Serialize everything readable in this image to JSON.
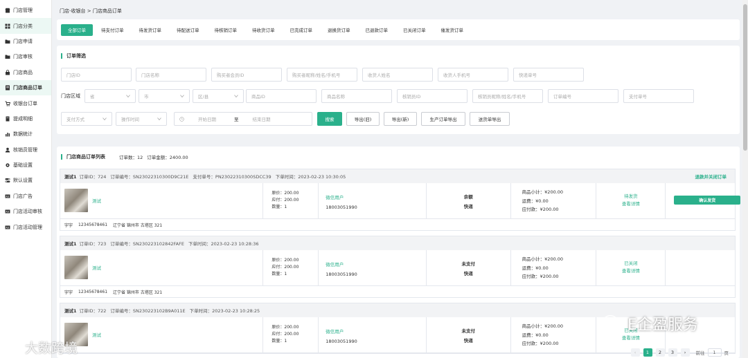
{
  "sidebar": {
    "items": [
      {
        "label": "门店管理",
        "icon": "store-icon"
      },
      {
        "label": "门店分类",
        "icon": "grid-icon",
        "active": true
      },
      {
        "label": "门店申请",
        "icon": "folder-icon"
      },
      {
        "label": "门店审核",
        "icon": "folder-icon"
      },
      {
        "label": "门店商品",
        "icon": "bag-icon"
      },
      {
        "label": "门店商品订单",
        "icon": "doc-icon",
        "active": true,
        "bold": true
      },
      {
        "label": "收银台订单",
        "icon": "cart-icon"
      },
      {
        "label": "提成明细",
        "icon": "note-icon"
      },
      {
        "label": "数据统计",
        "icon": "chart-icon"
      },
      {
        "label": "核销员管理",
        "icon": "user-icon"
      },
      {
        "label": "基础设置",
        "icon": "gear-icon"
      },
      {
        "label": "默认设置",
        "icon": "toggle-icon"
      },
      {
        "label": "门店广告",
        "icon": "ad-icon"
      },
      {
        "label": "门店活动审核",
        "icon": "ad-icon"
      },
      {
        "label": "门店活动管理",
        "icon": "ad-icon"
      }
    ]
  },
  "breadcrumb": "门店-收银台 > 门店商品订单",
  "tabs": [
    "全部订单",
    "待支付订单",
    "待发货订单",
    "待配送订单",
    "待核销订单",
    "待收货订单",
    "已完成订单",
    "退换货订单",
    "已退款订单",
    "已关闭订单",
    "催发货订单"
  ],
  "filter": {
    "title": "订单筛选",
    "row1": [
      "门店ID",
      "门店名称",
      "购买者会员ID",
      "购买者昵称/姓名/手机号",
      "收货人姓名",
      "收货人手机号",
      "快递单号"
    ],
    "region_label": "门店区域",
    "region_selects": [
      "省",
      "市",
      "区/县"
    ],
    "row2": [
      "商品ID",
      "商品名称",
      "核销员ID",
      "核销员昵称/姓名/手机号",
      "订单编号",
      "支付单号"
    ],
    "pay_method": "支付方式",
    "op_time": "操作时间",
    "date_start": "开始日期",
    "date_sep": "至",
    "date_end": "结束日期",
    "buttons": {
      "search": "搜索",
      "export_old": "导出(旧)",
      "export_new": "导出(新)",
      "export_prod": "生产订单导出",
      "export_ship": "送货单导出"
    }
  },
  "list": {
    "title": "门店商品订单列表",
    "order_count": "订单数：12",
    "order_amount": "订单金额：2400.00",
    "orders": [
      {
        "store": "测试1",
        "id": "订单ID：724",
        "no": "订单编号：SN23022310300D9C21E",
        "pay_no": "支付单号：PN23022310300SDCC39",
        "time": "下单时间：2023-02-23 10:30:05",
        "close_link": "退款并关闭订单",
        "goods": "测试",
        "prices": [
          "原价：200.00",
          "应付：200.00",
          "数量：1"
        ],
        "buyer_name": "微信用户",
        "buyer_phone": "18003051990",
        "pay_method": "余额",
        "ship_method": "快递",
        "sum": [
          "商品小计：¥200.00",
          "运费：¥0.00",
          "应付款：¥200.00"
        ],
        "status": "待发货",
        "detail": "查看详情",
        "action": "确认发货",
        "addr": [
          "宇宇",
          "12345678461",
          "辽宁省 锦州市 古塔区 321"
        ]
      },
      {
        "store": "测试1",
        "id": "订单ID：723",
        "no": "订单编号：SN230223102842FAFE",
        "time": "下单时间：2023-02-23 10:28:36",
        "goods": "测试",
        "prices": [
          "原价：200.00",
          "应付：200.00",
          "数量：1"
        ],
        "buyer_name": "微信用户",
        "buyer_phone": "18003051990",
        "pay_method": "未支付",
        "ship_method": "快递",
        "sum": [
          "商品小计：¥200.00",
          "运费：¥0.00",
          "应付款：¥200.00"
        ],
        "status": "已关闭",
        "detail": "查看详情",
        "addr": [
          "宇宇",
          "12345678461",
          "辽宁省 锦州市 古塔区 321"
        ]
      },
      {
        "store": "测试1",
        "id": "订单ID：722",
        "no": "订单编号：SN230223102B9A011E",
        "time": "下单时间：2023-02-23 10:28:25",
        "goods": "测试",
        "prices": [
          "原价：200.00",
          "应付：200.00",
          "数量：1"
        ],
        "buyer_name": "微信用户",
        "buyer_phone": "18003051990",
        "pay_method": "未支付",
        "ship_method": "快递",
        "sum": [
          "商品小计：¥200.00",
          "运费：¥0.00",
          "应付款：¥200.00"
        ],
        "status": "已关闭",
        "detail": "查看详情"
      }
    ]
  },
  "pagination": {
    "pages": [
      "1",
      "2",
      "3"
    ],
    "goto_label": "前往",
    "goto_value": "1",
    "page_unit": "页"
  },
  "watermarks": {
    "left": "大数跨境",
    "right": "E企盈服务"
  },
  "colors": {
    "accent": "#2ab08b"
  }
}
